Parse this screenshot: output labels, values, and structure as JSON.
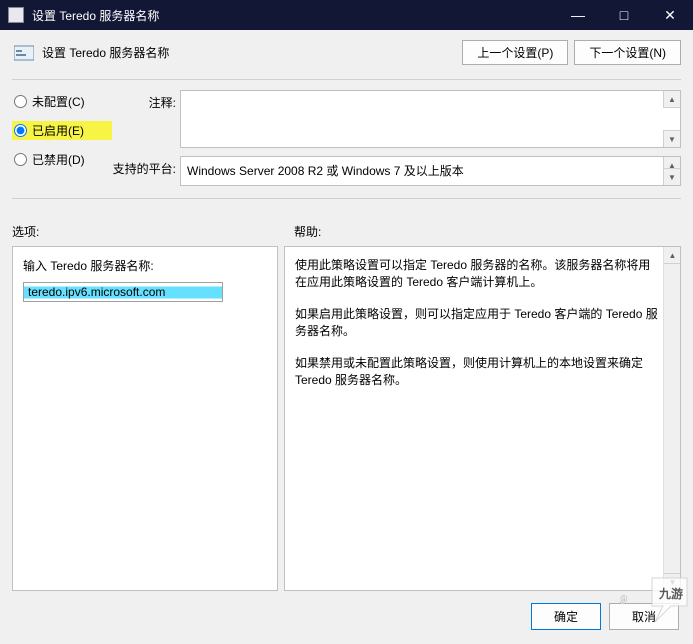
{
  "window": {
    "title": "设置 Teredo 服务器名称",
    "minimize": "—",
    "maximize": "□",
    "close": "✕"
  },
  "header": {
    "title": "设置 Teredo 服务器名称",
    "prev": "上一个设置(P)",
    "next": "下一个设置(N)"
  },
  "radios": {
    "not_configured": "未配置(C)",
    "enabled": "已启用(E)",
    "disabled": "已禁用(D)",
    "selected": "enabled"
  },
  "fields": {
    "comment_label": "注释:",
    "comment_value": "",
    "platform_label": "支持的平台:",
    "platform_value": "Windows Server 2008 R2 或 Windows 7 及以上版本"
  },
  "sections": {
    "options": "选项:",
    "help": "帮助:"
  },
  "options_panel": {
    "label": "输入 Teredo 服务器名称:",
    "value": "teredo.ipv6.microsoft.com"
  },
  "help_panel": {
    "p1": "使用此策略设置可以指定 Teredo 服务器的名称。该服务器名称将用在应用此策略设置的 Teredo 客户端计算机上。",
    "p2": "如果启用此策略设置，则可以指定应用于 Teredo 客户端的 Teredo 服务器名称。",
    "p3": "如果禁用或未配置此策略设置，则使用计算机上的本地设置来确定 Teredo 服务器名称。"
  },
  "footer": {
    "ok": "确定",
    "cancel": "取消"
  },
  "watermark": {
    "text": "九游"
  }
}
